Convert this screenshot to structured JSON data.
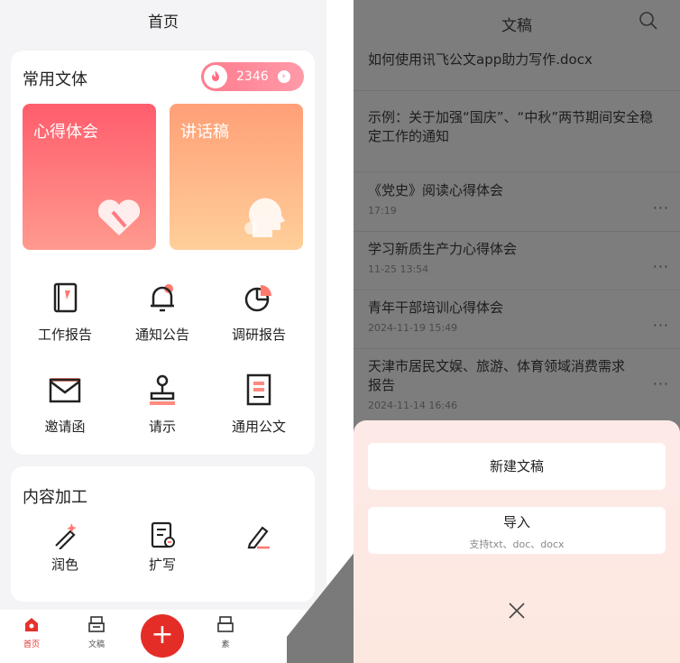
{
  "left": {
    "title": "首页",
    "section1_title": "常用文体",
    "badge_count": "2346",
    "cards": [
      {
        "label": "心得体会"
      },
      {
        "label": "讲话稿"
      }
    ],
    "grid": [
      {
        "label": "工作报告",
        "icon": "notebook-icon"
      },
      {
        "label": "通知公告",
        "icon": "bell-icon"
      },
      {
        "label": "调研报告",
        "icon": "pie-chart-icon"
      },
      {
        "label": "邀请函",
        "icon": "envelope-icon"
      },
      {
        "label": "请示",
        "icon": "stamp-icon"
      },
      {
        "label": "通用公文",
        "icon": "document-icon"
      }
    ],
    "section2_title": "内容加工",
    "tools": [
      {
        "label": "润色",
        "icon": "magic-pen-icon"
      },
      {
        "label": "扩写",
        "icon": "expand-doc-icon"
      },
      {
        "label": "",
        "icon": "pencil-icon"
      }
    ],
    "tabs": [
      {
        "label": "首页"
      },
      {
        "label": "文稿"
      },
      {
        "label": "素"
      }
    ],
    "fab": "+"
  },
  "right": {
    "title": "文稿",
    "docs": [
      {
        "name": "如何使用讯飞公文app助力写作.docx",
        "date": ""
      },
      {
        "name": "示例：关于加强“国庆”、“中秋”两节期间安全稳定工作的通知",
        "date": ""
      },
      {
        "name": "《党史》阅读心得体会",
        "date": "17:19"
      },
      {
        "name": "学习新质生产力心得体会",
        "date": "11-25 13:54"
      },
      {
        "name": "青年干部培训心得体会",
        "date": "2024-11-19 15:49"
      },
      {
        "name": "天津市居民文娱、旅游、体育领域消费需求报告",
        "date": "2024-11-14 16:46"
      }
    ],
    "more_glyph": "···",
    "sheet": {
      "new_label": "新建文稿",
      "import_label": "导入",
      "import_sub": "支持txt、doc、docx",
      "close": "×"
    }
  },
  "colors": {
    "accent": "#e52d27",
    "card_red": "#ff5d6c",
    "card_orange": "#ff9f77"
  }
}
